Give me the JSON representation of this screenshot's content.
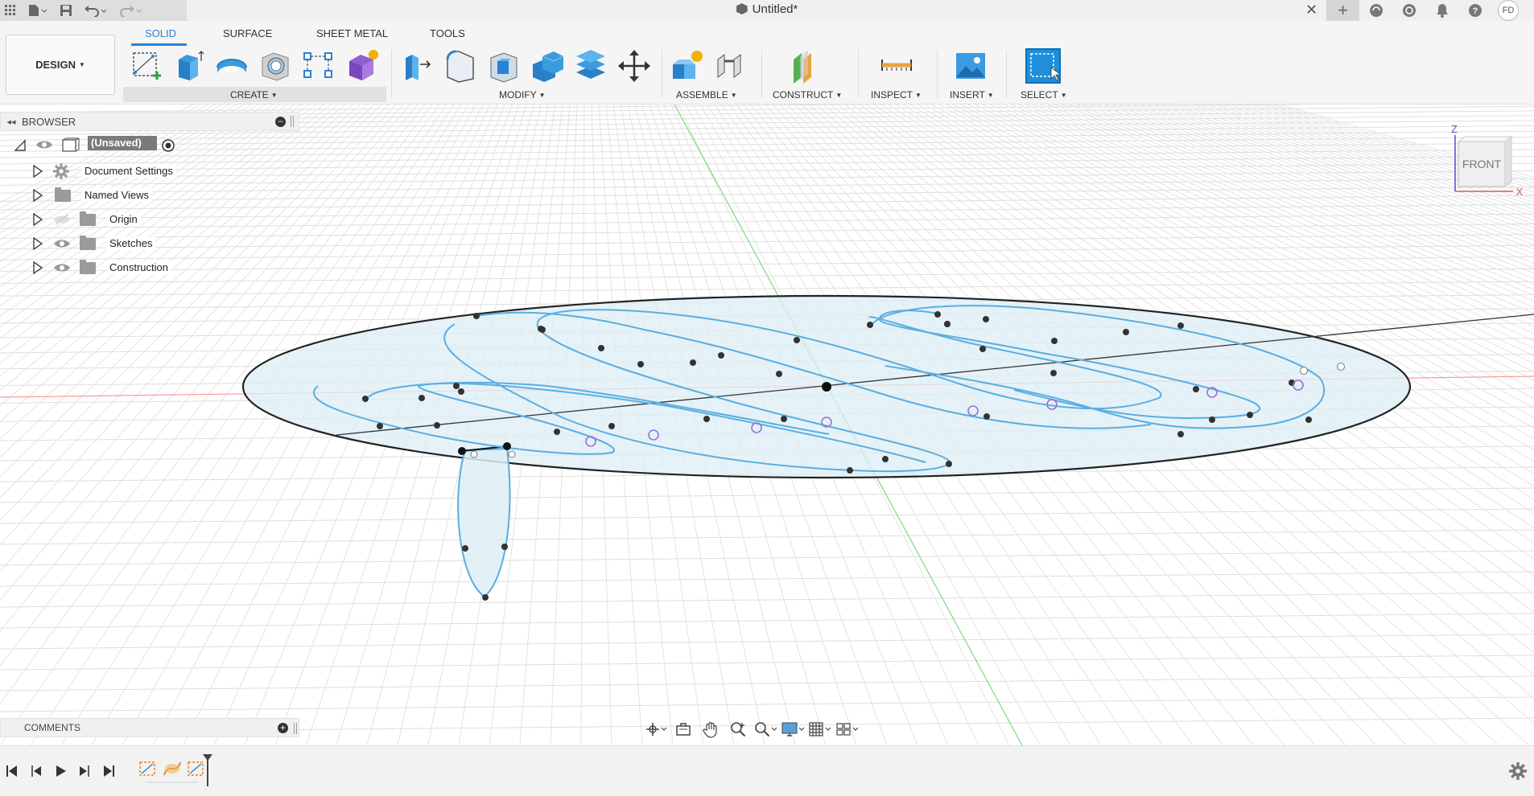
{
  "titlebar": {
    "document_title": "Untitled*",
    "close_symbol": "✕",
    "user_initials": "FD",
    "icons": [
      "app-grid-icon",
      "file-menu-icon",
      "save-icon",
      "undo-icon",
      "redo-icon",
      "new-tab-icon",
      "extensions-icon",
      "job-status-icon",
      "notifications-icon",
      "help-icon"
    ]
  },
  "toolbar": {
    "workspace": "DESIGN",
    "tabs": [
      {
        "label": "SOLID",
        "active": true
      },
      {
        "label": "SURFACE",
        "active": false
      },
      {
        "label": "SHEET METAL",
        "active": false
      },
      {
        "label": "TOOLS",
        "active": false
      }
    ],
    "groups": {
      "create": "CREATE",
      "modify": "MODIFY",
      "assemble": "ASSEMBLE",
      "construct": "CONSTRUCT",
      "inspect": "INSPECT",
      "insert": "INSERT",
      "select": "SELECT"
    },
    "tool_icons": {
      "create": [
        "create-sketch-icon",
        "extrude-icon",
        "revolve-icon",
        "hole-icon",
        "pattern-icon",
        "create-form-icon"
      ],
      "modify": [
        "press-pull-icon",
        "fillet-icon",
        "shell-icon",
        "combine-icon",
        "offset-face-icon",
        "move-icon"
      ],
      "assemble": [
        "new-component-icon",
        "joint-icon"
      ],
      "construct": [
        "offset-plane-icon"
      ],
      "inspect": [
        "measure-icon"
      ],
      "insert": [
        "insert-image-icon"
      ],
      "select": [
        "select-window-icon"
      ]
    }
  },
  "browser": {
    "title": "BROWSER",
    "root": "(Unsaved)",
    "items": [
      {
        "label": "Document Settings",
        "icon": "gear-icon",
        "visibility": "none"
      },
      {
        "label": "Named Views",
        "icon": "folder-icon",
        "visibility": "none"
      },
      {
        "label": "Origin",
        "icon": "folder-icon",
        "visibility": "hidden"
      },
      {
        "label": "Sketches",
        "icon": "folder-icon",
        "visibility": "visible"
      },
      {
        "label": "Construction",
        "icon": "folder-icon",
        "visibility": "visible"
      }
    ]
  },
  "comments": {
    "title": "COMMENTS"
  },
  "viewcube": {
    "face": "FRONT",
    "axis_z": "Z",
    "axis_x": "X"
  },
  "navbar": {
    "icons": [
      "orbit-icon",
      "look-at-icon",
      "pan-icon",
      "zoom-icon",
      "zoom-window-icon",
      "display-settings-icon",
      "grid-settings-icon",
      "viewports-icon"
    ]
  },
  "timeline": {
    "icons": [
      "go-to-start-icon",
      "step-back-icon",
      "play-icon",
      "step-forward-icon",
      "go-to-end-icon",
      "sketch-feature-icon",
      "spline-feature-icon",
      "sketch-feature-2-icon",
      "timeline-marker-icon",
      "settings-gear-icon"
    ]
  },
  "colors": {
    "accent": "#2a82d7",
    "sketch_curve": "#5aaee0",
    "sketch_fill": "#dbeef7",
    "constraint_point": "#9c6fd6",
    "grid": "#d9d9d9",
    "x_axis": "#ff8080",
    "y_axis": "#60d060"
  }
}
